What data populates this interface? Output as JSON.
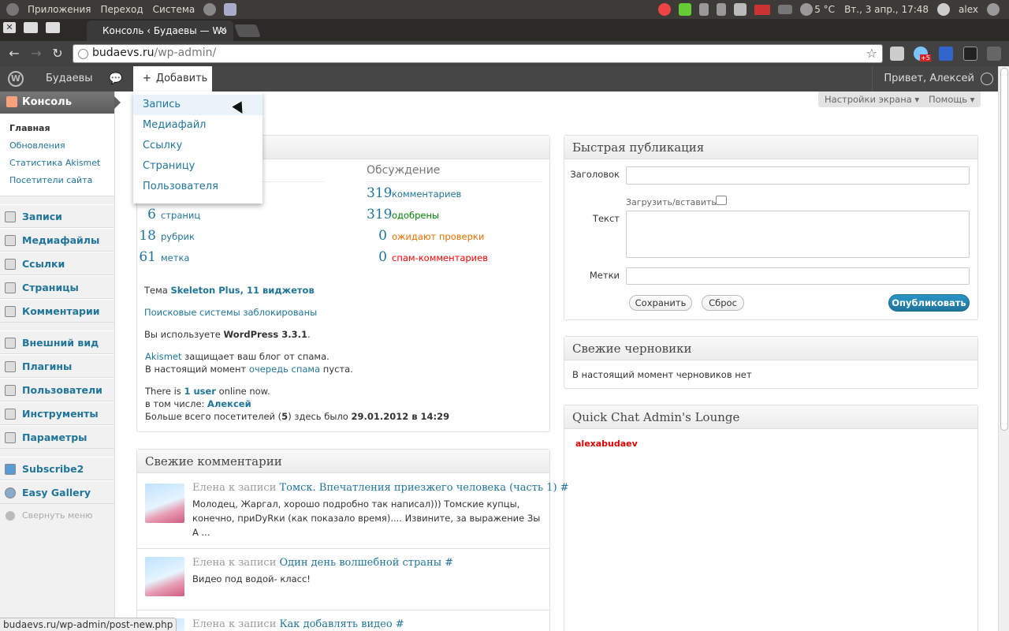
{
  "os_panel": {
    "menu": [
      "Приложения",
      "Переход",
      "Система"
    ],
    "weather": "5 °C",
    "clock": "Вт., 3 апр., 17:48",
    "user": "alex"
  },
  "browser": {
    "tab_title": "Консоль ‹ Будаевы — Wo",
    "url_host": "budaevs.ru",
    "url_path": "/wp-admin/",
    "status_url": "budaevs.ru/wp-admin/post-new.php",
    "ext_badge": "+5"
  },
  "adminbar": {
    "site_name": "Будаевы",
    "new_label": "Добавить",
    "account": "Привет, Алексей"
  },
  "new_menu": [
    "Запись",
    "Медиафайл",
    "Ссылку",
    "Страницу",
    "Пользователя"
  ],
  "sidebar": {
    "dashboard": "Консоль",
    "submenu": [
      "Главная",
      "Обновления",
      "Статистика Akismet",
      "Посетители сайта"
    ],
    "group1": [
      "Записи",
      "Медиафайлы",
      "Ссылки",
      "Страницы",
      "Комментарии"
    ],
    "group2": [
      "Внешний вид",
      "Плагины",
      "Пользователи",
      "Инструменты",
      "Параметры"
    ],
    "group3": [
      "Subscribe2",
      "Easy Gallery"
    ],
    "collapse": "Свернуть меню"
  },
  "screen_options": "Настройки экрана",
  "help": "Помощь",
  "right_now": {
    "discussion_title": "Обсуждение",
    "content": [
      {
        "num": "6",
        "label": "страниц"
      },
      {
        "num": "18",
        "label": "рубрик"
      },
      {
        "num": "61",
        "label": "метка"
      }
    ],
    "discussion": [
      {
        "num": "319",
        "label": "комментариев",
        "color": "#21759b"
      },
      {
        "num": "319",
        "label": "одобрены",
        "color": "#008000"
      },
      {
        "num": "0",
        "label": "ожидают проверки",
        "color": "#e66f00"
      },
      {
        "num": "0",
        "label": "спам-комментариев",
        "color": "#ff0000"
      }
    ],
    "theme_prefix": "Тема ",
    "theme_name": "Skeleton Plus",
    "theme_widgets": "11 виджетов",
    "search_blocked": "Поисковые системы заблокированы",
    "wp_prefix": "Вы используете ",
    "wp_version": "WordPress 3.3.1",
    "akismet_link": "Akismet",
    "akismet_text": " защищает ваш блог от спама.",
    "akismet_queue_prefix": "В настоящий момент ",
    "akismet_queue_link": "очередь спама",
    "akismet_queue_suffix": " пуста.",
    "online_prefix": "There is ",
    "online_count": "1 user",
    "online_suffix": " online now.",
    "incl_prefix": "в том числе: ",
    "incl_user": "Алексей",
    "max_prefix": "Больше всего посетителей (",
    "max_count": "5",
    "max_mid": ") здесь было ",
    "max_date": "29.01.2012 в 14:29"
  },
  "quick_press": {
    "title": "Быстрая публикация",
    "title_label": "Заголовок",
    "upload_label": "Загрузить/вставить",
    "text_label": "Текст",
    "tags_label": "Метки",
    "save": "Сохранить",
    "reset": "Сброс",
    "publish": "Опубликовать"
  },
  "drafts": {
    "title": "Свежие черновики",
    "empty": "В настоящий момент черновиков нет"
  },
  "chat": {
    "title": "Quick Chat Admin's Lounge",
    "user": "alexabudaev"
  },
  "comments": {
    "title": "Свежие комментарии",
    "items": [
      {
        "author": "Елена к записи ",
        "post": "Томск. Впечатления приезжего человека (часть 1) #",
        "text": "Молодец, Жаргал, хорошо подробно так написал))) Томские купцы, конечно, приDyRки (как показало время).... Извините, за выражение Зы А ..."
      },
      {
        "author": "Елена к записи ",
        "post": "Один день волшебной страны #",
        "text": "Видео под водой- класс!"
      },
      {
        "author": "Елена к записи ",
        "post": "Как добавлять видео #",
        "text": ""
      }
    ]
  },
  "colors": {
    "link": "#21759b",
    "adminbar": "#464646",
    "chat_user": "#dd0000",
    "os_panel": "#3c3b37"
  }
}
